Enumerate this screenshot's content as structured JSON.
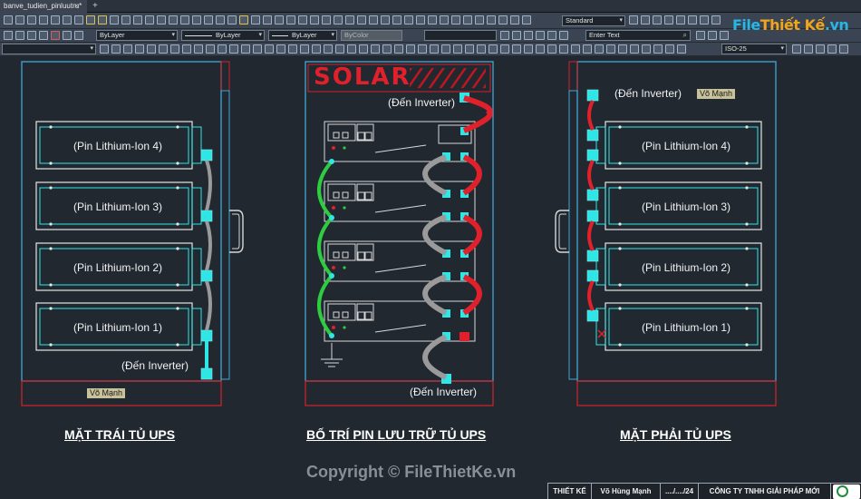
{
  "tab": {
    "title": "banve_tudien_pinluutru*",
    "close": "×",
    "new": "+"
  },
  "toolbar": {
    "text_style": "Standard",
    "layer1": "ByLayer",
    "linetype": "ByLayer",
    "lineweight": "ByLayer",
    "color": "ByColor",
    "search_placeholder": "Enter Text",
    "dim_style": "ISO-25"
  },
  "watermark": {
    "brand_a": "File",
    "brand_b": "Thiết Kế",
    "brand_c": ".vn"
  },
  "drawing": {
    "solar_label": "SOLAR",
    "pins": [
      "(Pin Lithium-Ion 4)",
      "(Pin Lithium-Ion 3)",
      "(Pin Lithium-Ion 2)",
      "(Pin Lithium-Ion 1)"
    ],
    "inverter_left": "(Đến Inverter)",
    "inverter_center_top": "(Đến Inverter)",
    "inverter_center_bottom": "(Đến Inverter)",
    "inverter_right": "(Đến Inverter)",
    "author_tag_left": "Võ Mạnh",
    "author_tag_right": "Võ Mạnh",
    "title_left": "MẶT TRÁI TỦ UPS",
    "title_center": "BỐ TRÍ PIN LƯU TRỮ TỦ UPS",
    "title_right": "MẶT PHẢI TỦ UPS",
    "copyright": "Copyright © FileThietKe.vn"
  },
  "title_block": {
    "role": "THIẾT KẾ",
    "name": "Võ Hùng Mạnh",
    "date": "..../..../24",
    "company": "CÔNG TY TNHH GIẢI PHÁP MỚI"
  },
  "colors": {
    "cyan": "#2ee6e6",
    "red": "#e0202a",
    "green": "#2ecc40",
    "grey": "#9a9a9a",
    "frame": "#3fa8d8"
  }
}
